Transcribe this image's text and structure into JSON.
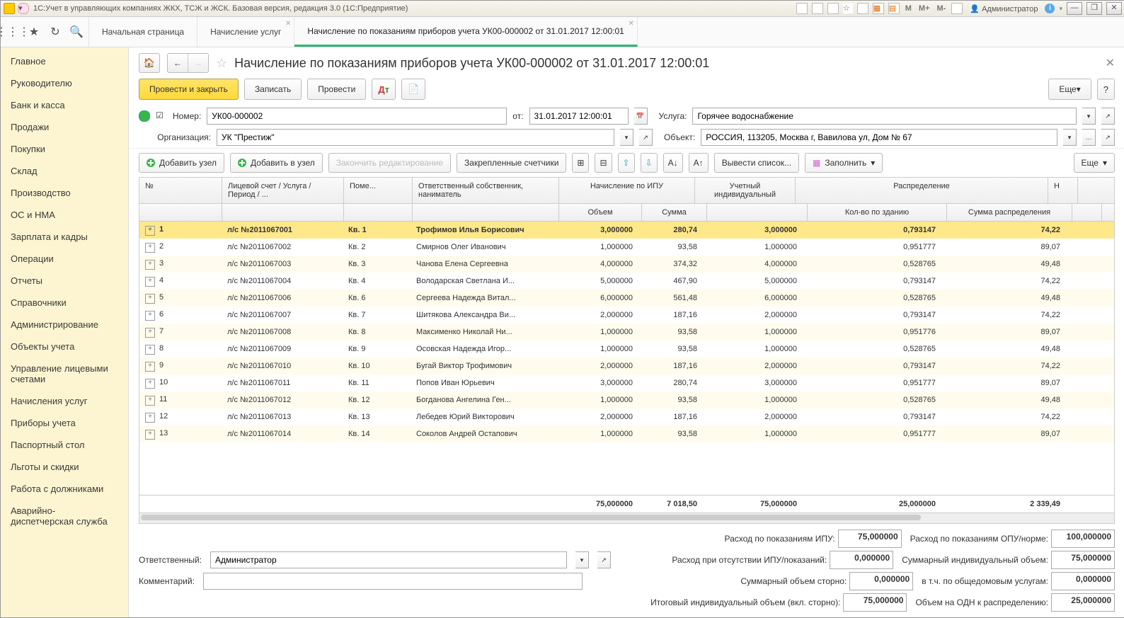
{
  "title_bar": "1С:Учет в управляющих компаниях ЖКХ, ТСЖ и ЖСК. Базовая версия, редакция 3.0  (1С:Предприятие)",
  "user": "Администратор",
  "toolbar_m": [
    "M",
    "M+",
    "M-"
  ],
  "tabs": [
    {
      "label": "Начальная страница",
      "active": false
    },
    {
      "label": "Начисление услуг",
      "active": false
    },
    {
      "label": "Начисление по показаниям приборов учета УК00-000002 от 31.01.2017 12:00:01",
      "active": true
    }
  ],
  "sidebar": [
    "Главное",
    "Руководителю",
    "Банк и касса",
    "Продажи",
    "Покупки",
    "Склад",
    "Производство",
    "ОС и НМА",
    "Зарплата и кадры",
    "Операции",
    "Отчеты",
    "Справочники",
    "Администрирование",
    "Объекты учета",
    "Управление лицевыми счетами",
    "Начисления услуг",
    "Приборы учета",
    "Паспортный стол",
    "Льготы и скидки",
    "Работа с должниками",
    "Аварийно-диспетчерская служба"
  ],
  "header_title": "Начисление по показаниям приборов учета УК00-000002 от 31.01.2017 12:00:01",
  "btns": {
    "post_close": "Провести и закрыть",
    "write": "Записать",
    "post": "Провести",
    "more": "Еще",
    "help": "?"
  },
  "form": {
    "number_lbl": "Номер:",
    "number": "УК00-000002",
    "from_lbl": "от:",
    "date": "31.01.2017 12:00:01",
    "service_lbl": "Услуга:",
    "service": "Горячее водоснабжение",
    "org_lbl": "Организация:",
    "org": "УК \"Престиж\"",
    "object_lbl": "Объект:",
    "object": "РОССИЯ, 113205, Москва г, Вавилова ул, Дом № 67"
  },
  "tbar": {
    "add_node": "Добавить узел",
    "add_in": "Добавить в узел",
    "finish": "Закончить редактирование",
    "fixed": "Закрепленные счетчики",
    "out": "Вывести список...",
    "fill": "Заполнить",
    "more": "Еще"
  },
  "columns": {
    "no": "№",
    "acc": "Лицевой счет / Услуга / Период / ...",
    "flat": "Поме...",
    "own": "Ответственный собственник, наниматель",
    "ipu": "Начисление по ИПУ",
    "vol": "Объем",
    "sum": "Сумма",
    "ind": "Учетный индивидуальный",
    "dist": "Распределение",
    "qty": "Кол-во по зданию",
    "distsum": "Сумма распределения",
    "h": "Н"
  },
  "rows": [
    {
      "n": "1",
      "acc": "л/с №2011067001",
      "flat": "Кв. 1",
      "own": "Трофимов Илья Борисович",
      "vol": "3,000000",
      "sum": "280,74",
      "ind": "3,000000",
      "qty": "0,793147",
      "dist": "74,22",
      "sel": true
    },
    {
      "n": "2",
      "acc": "л/с №2011067002",
      "flat": "Кв. 2",
      "own": "Смирнов Олег Иванович",
      "vol": "1,000000",
      "sum": "93,58",
      "ind": "1,000000",
      "qty": "0,951777",
      "dist": "89,07"
    },
    {
      "n": "3",
      "acc": "л/с №2011067003",
      "flat": "Кв. 3",
      "own": "Чанова Елена Сергеевна",
      "vol": "4,000000",
      "sum": "374,32",
      "ind": "4,000000",
      "qty": "0,528765",
      "dist": "49,48"
    },
    {
      "n": "4",
      "acc": "л/с №2011067004",
      "flat": "Кв. 4",
      "own": "Володарская Светлана И...",
      "vol": "5,000000",
      "sum": "467,90",
      "ind": "5,000000",
      "qty": "0,793147",
      "dist": "74,22"
    },
    {
      "n": "5",
      "acc": "л/с №2011067006",
      "flat": "Кв. 6",
      "own": "Сергеева Надежда Витал...",
      "vol": "6,000000",
      "sum": "561,48",
      "ind": "6,000000",
      "qty": "0,528765",
      "dist": "49,48"
    },
    {
      "n": "6",
      "acc": "л/с №2011067007",
      "flat": "Кв. 7",
      "own": "Шитякова Александра Ви...",
      "vol": "2,000000",
      "sum": "187,16",
      "ind": "2,000000",
      "qty": "0,793147",
      "dist": "74,22"
    },
    {
      "n": "7",
      "acc": "л/с №2011067008",
      "flat": "Кв. 8",
      "own": "Максименко Николай Ни...",
      "vol": "1,000000",
      "sum": "93,58",
      "ind": "1,000000",
      "qty": "0,951776",
      "dist": "89,07"
    },
    {
      "n": "8",
      "acc": "л/с №2011067009",
      "flat": "Кв. 9",
      "own": "Осовская Надежда Игор...",
      "vol": "1,000000",
      "sum": "93,58",
      "ind": "1,000000",
      "qty": "0,528765",
      "dist": "49,48"
    },
    {
      "n": "9",
      "acc": "л/с №2011067010",
      "flat": "Кв. 10",
      "own": "Бугай Виктор Трофимович",
      "vol": "2,000000",
      "sum": "187,16",
      "ind": "2,000000",
      "qty": "0,793147",
      "dist": "74,22"
    },
    {
      "n": "10",
      "acc": "л/с №2011067011",
      "flat": "Кв. 11",
      "own": "Попов Иван Юрьевич",
      "vol": "3,000000",
      "sum": "280,74",
      "ind": "3,000000",
      "qty": "0,951777",
      "dist": "89,07"
    },
    {
      "n": "11",
      "acc": "л/с №2011067012",
      "flat": "Кв. 12",
      "own": "Богданова Ангелина Ген...",
      "vol": "1,000000",
      "sum": "93,58",
      "ind": "1,000000",
      "qty": "0,528765",
      "dist": "49,48"
    },
    {
      "n": "12",
      "acc": "л/с №2011067013",
      "flat": "Кв. 13",
      "own": "Лебедев Юрий Викторович",
      "vol": "2,000000",
      "sum": "187,16",
      "ind": "2,000000",
      "qty": "0,793147",
      "dist": "74,22"
    },
    {
      "n": "13",
      "acc": "л/с №2011067014",
      "flat": "Кв. 14",
      "own": "Соколов Андрей Остапович",
      "vol": "1,000000",
      "sum": "93,58",
      "ind": "1,000000",
      "qty": "0,951777",
      "dist": "89,07"
    }
  ],
  "totals": {
    "vol": "75,000000",
    "sum": "7 018,50",
    "ind": "75,000000",
    "qty": "25,000000",
    "dist": "2 339,49"
  },
  "summary": {
    "r1a_lbl": "Расход по показаниям ИПУ:",
    "r1a": "75,000000",
    "r1b_lbl": "Расход по показаниям ОПУ/норме:",
    "r1b": "100,000000",
    "r2a_lbl": "Расход при отсутствии ИПУ/показаний:",
    "r2a": "0,000000",
    "r2b_lbl": "Суммарный индивидуальный объем:",
    "r2b": "75,000000",
    "r3a_lbl": "Суммарный объем сторно:",
    "r3a": "0,000000",
    "r3b_lbl": "в т.ч. по общедомовым услугам:",
    "r3b": "0,000000",
    "r4a_lbl": "Итоговый индивидуальный объем (вкл. сторно):",
    "r4a": "75,000000",
    "r4b_lbl": "Объем на ОДН к распределению:",
    "r4b": "25,000000"
  },
  "bottom": {
    "resp_lbl": "Ответственный:",
    "resp": "Администратор",
    "comm_lbl": "Комментарий:",
    "comm": ""
  }
}
